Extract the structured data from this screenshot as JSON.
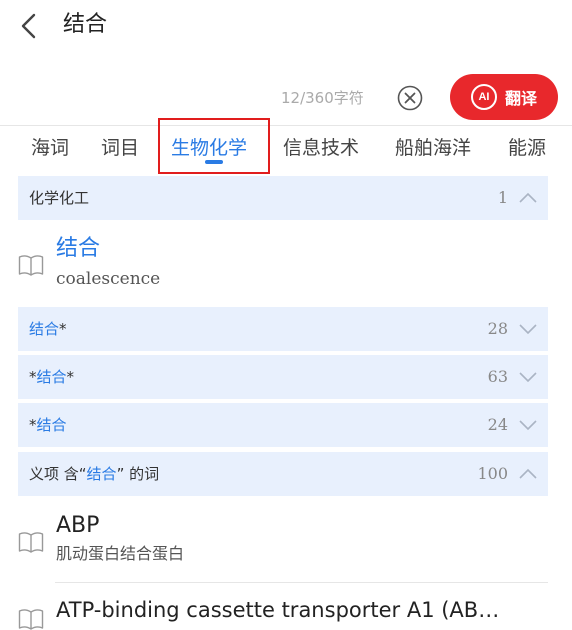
{
  "header": {
    "title": "结合"
  },
  "input": {
    "counter": "12/360字符"
  },
  "translate_button": {
    "badge": "AI",
    "label": "翻译"
  },
  "tabs": [
    {
      "label": "海词"
    },
    {
      "label": "词目"
    },
    {
      "label": "生物化学",
      "active": true
    },
    {
      "label": "信息技术"
    },
    {
      "label": "船舶海洋"
    },
    {
      "label": "能源"
    }
  ],
  "sections": {
    "chemical": {
      "label": "化学化工",
      "count": "1",
      "state": "expanded"
    },
    "prefix": {
      "label_term": "结合",
      "label_suffix": "*",
      "count": "28",
      "state": "collapsed"
    },
    "infix": {
      "label_prefix": "*",
      "label_term": "结合",
      "label_suffix": "*",
      "count": "63",
      "state": "collapsed"
    },
    "suffix": {
      "label_prefix": "*",
      "label_term": "结合",
      "count": "24",
      "state": "collapsed"
    },
    "meaning": {
      "label_prefix": "义项 含“",
      "label_term": "结合",
      "label_suffix": "” 的词",
      "count": "100",
      "state": "expanded"
    }
  },
  "entries": {
    "main": {
      "word": "结合",
      "translation": "coalescence"
    },
    "abp": {
      "word": "ABP",
      "translation": "肌动蛋白结合蛋白"
    },
    "atp": {
      "word": "ATP-binding cassette transporter A1 (AB…"
    }
  },
  "colors": {
    "accent": "#2a7be4",
    "brand_red": "#e8282c",
    "section_bg": "#e8f0fd"
  }
}
